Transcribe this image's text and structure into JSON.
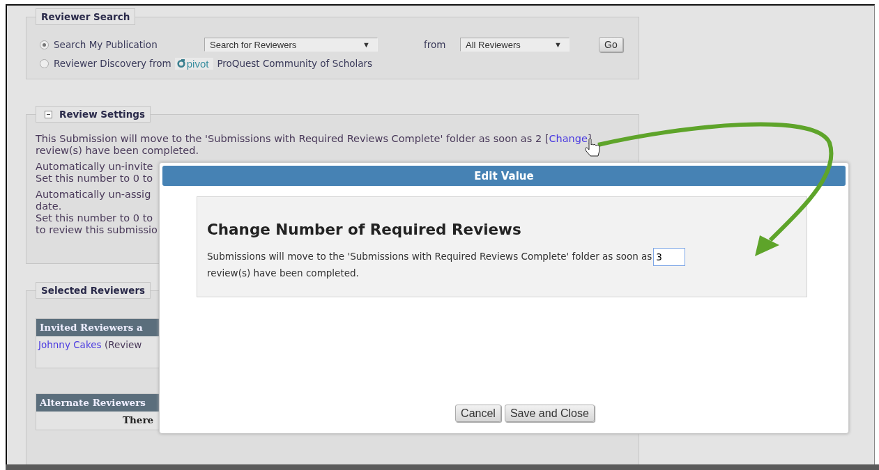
{
  "reviewer_search": {
    "legend": "Reviewer Search",
    "options": [
      {
        "label": "Search My Publication",
        "selected": true
      },
      {
        "label": "Reviewer Discovery from",
        "selected": false,
        "logo_text": "pivot",
        "suffix": "ProQuest Community of Scholars"
      }
    ],
    "search_select": {
      "value": "Search for Reviewers",
      "arrow": "▼"
    },
    "from_label": "from",
    "source_select": {
      "value": "All Reviewers",
      "arrow": "▼"
    },
    "go_button": "Go"
  },
  "review_settings": {
    "legend": "Review Settings",
    "expanded": true,
    "required": {
      "before": "This Submission will move to the 'Submissions with Required Reviews Complete' folder as soon as 2 [",
      "link": "Change",
      "close": "]",
      "rest": "review(s) have been completed."
    },
    "uninvite_lines": [
      "Automatically un-invite",
      "Set this number to 0 to"
    ],
    "unassign_lines": [
      "Automatically un-assig",
      "date.",
      "Set this number to 0 to",
      "to review this submissio"
    ]
  },
  "selected_reviewers": {
    "legend": "Selected Reviewers",
    "invited": {
      "header": "Invited Reviewers a",
      "reviewer_name": "Johnny Cakes",
      "reviewer_role": "(Review"
    },
    "alternate": {
      "header": "Alternate Reviewers",
      "message": "There"
    }
  },
  "dialog": {
    "title": "Edit Value",
    "heading": "Change Number of Required Reviews",
    "text_before": "Submissions will move to the 'Submissions with Required Reviews Complete' folder as soon as",
    "value": "3",
    "text_after": "review(s) have been completed.",
    "buttons": [
      "Cancel",
      "Save and Close"
    ]
  }
}
